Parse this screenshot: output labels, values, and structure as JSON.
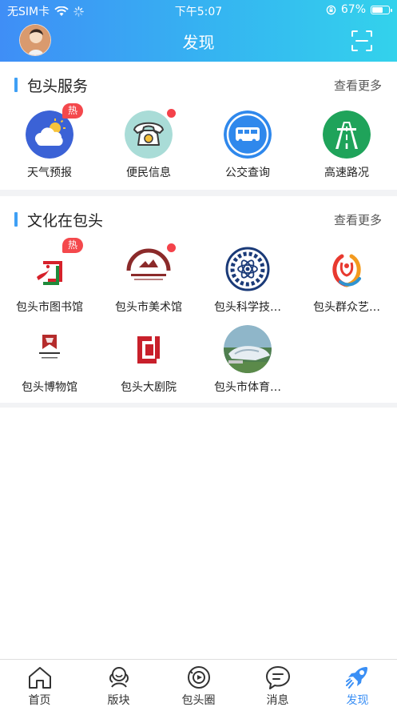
{
  "status": {
    "carrier": "无SIM卡",
    "time": "下午5:07",
    "battery": "67%",
    "battery_level": 0.67
  },
  "header": {
    "title": "发现"
  },
  "sections": [
    {
      "title": "包头服务",
      "more": "查看更多",
      "items": [
        {
          "label": "天气预报",
          "icon": "weather-icon",
          "badge": "热"
        },
        {
          "label": "便民信息",
          "icon": "telephone-icon",
          "dot": true
        },
        {
          "label": "公交查询",
          "icon": "bus-icon"
        },
        {
          "label": "高速路况",
          "icon": "highway-icon"
        }
      ]
    },
    {
      "title": "文化在包头",
      "more": "查看更多",
      "items": [
        {
          "label": "包头市图书馆",
          "icon": "library-logo",
          "badge": "热"
        },
        {
          "label": "包头市美术馆",
          "icon": "art-museum-logo",
          "dot": true
        },
        {
          "label": "包头科学技…",
          "icon": "science-museum-logo"
        },
        {
          "label": "包头群众艺…",
          "icon": "mass-art-center-logo"
        },
        {
          "label": "包头博物馆",
          "icon": "museum-logo"
        },
        {
          "label": "包头大剧院",
          "icon": "grand-theater-logo"
        },
        {
          "label": "包头市体育…",
          "icon": "sports-center-photo"
        }
      ]
    }
  ],
  "tabs": [
    {
      "label": "首页",
      "icon": "home-icon",
      "active": false
    },
    {
      "label": "版块",
      "icon": "board-icon",
      "active": false
    },
    {
      "label": "包头圈",
      "icon": "circle-icon",
      "active": false
    },
    {
      "label": "消息",
      "icon": "message-icon",
      "active": false
    },
    {
      "label": "发现",
      "icon": "discover-rocket-icon",
      "active": true
    }
  ],
  "colors": {
    "accent": "#3a8ff5",
    "header_start": "#3f8ef6",
    "header_end": "#33d2ec",
    "badge": "#f4484c"
  }
}
